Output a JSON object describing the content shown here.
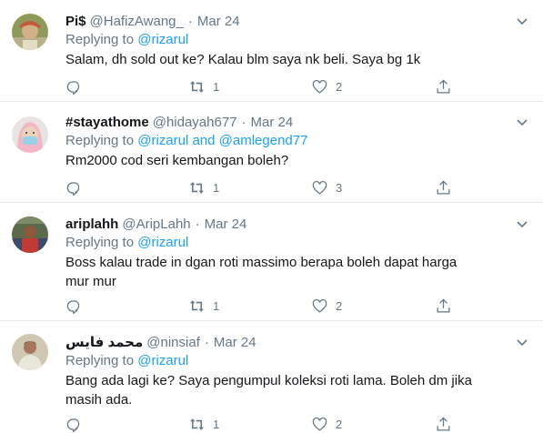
{
  "tweets": [
    {
      "name": "Pi$",
      "handle": "@HafizAwang_",
      "dot": "·",
      "date": "Mar 24",
      "replying_prefix": "Replying to",
      "mentions": "@rizarul",
      "text": "Salam, dh sold out ke? Kalau blm saya nk beli. Saya bg 1k",
      "retweets": "1",
      "likes": "2"
    },
    {
      "name": "#stayathome",
      "handle": "@hidayah677",
      "dot": "·",
      "date": "Mar 24",
      "replying_prefix": "Replying to",
      "mentions": "@rizarul and @amlegend77",
      "text": "Rm2000 cod seri kembangan boleh?",
      "retweets": "1",
      "likes": "3"
    },
    {
      "name": "ariplahh",
      "handle": "@AripLahh",
      "dot": "·",
      "date": "Mar 24",
      "replying_prefix": "Replying to",
      "mentions": "@rizarul",
      "text": "Boss kalau trade in dgan roti massimo berapa boleh dapat harga mur mur",
      "retweets": "1",
      "likes": "2"
    },
    {
      "name": "محمد فايس",
      "handle": "@ninsiaf",
      "dot": "·",
      "date": "Mar 24",
      "replying_prefix": "Replying to",
      "mentions": "@rizarul",
      "text": "Bang ada lagi ke? Saya pengumpul koleksi roti lama. Boleh dm jika masih ada.",
      "retweets": "1",
      "likes": "2"
    }
  ],
  "icons": {
    "reply": "reply-icon",
    "retweet": "retweet-icon",
    "like": "heart-icon",
    "share": "share-icon",
    "more": "chevron-down-icon"
  },
  "colors": {
    "link": "#1da1f2",
    "muted": "#657786",
    "text": "#14171a",
    "divider": "#e6ecf0"
  }
}
